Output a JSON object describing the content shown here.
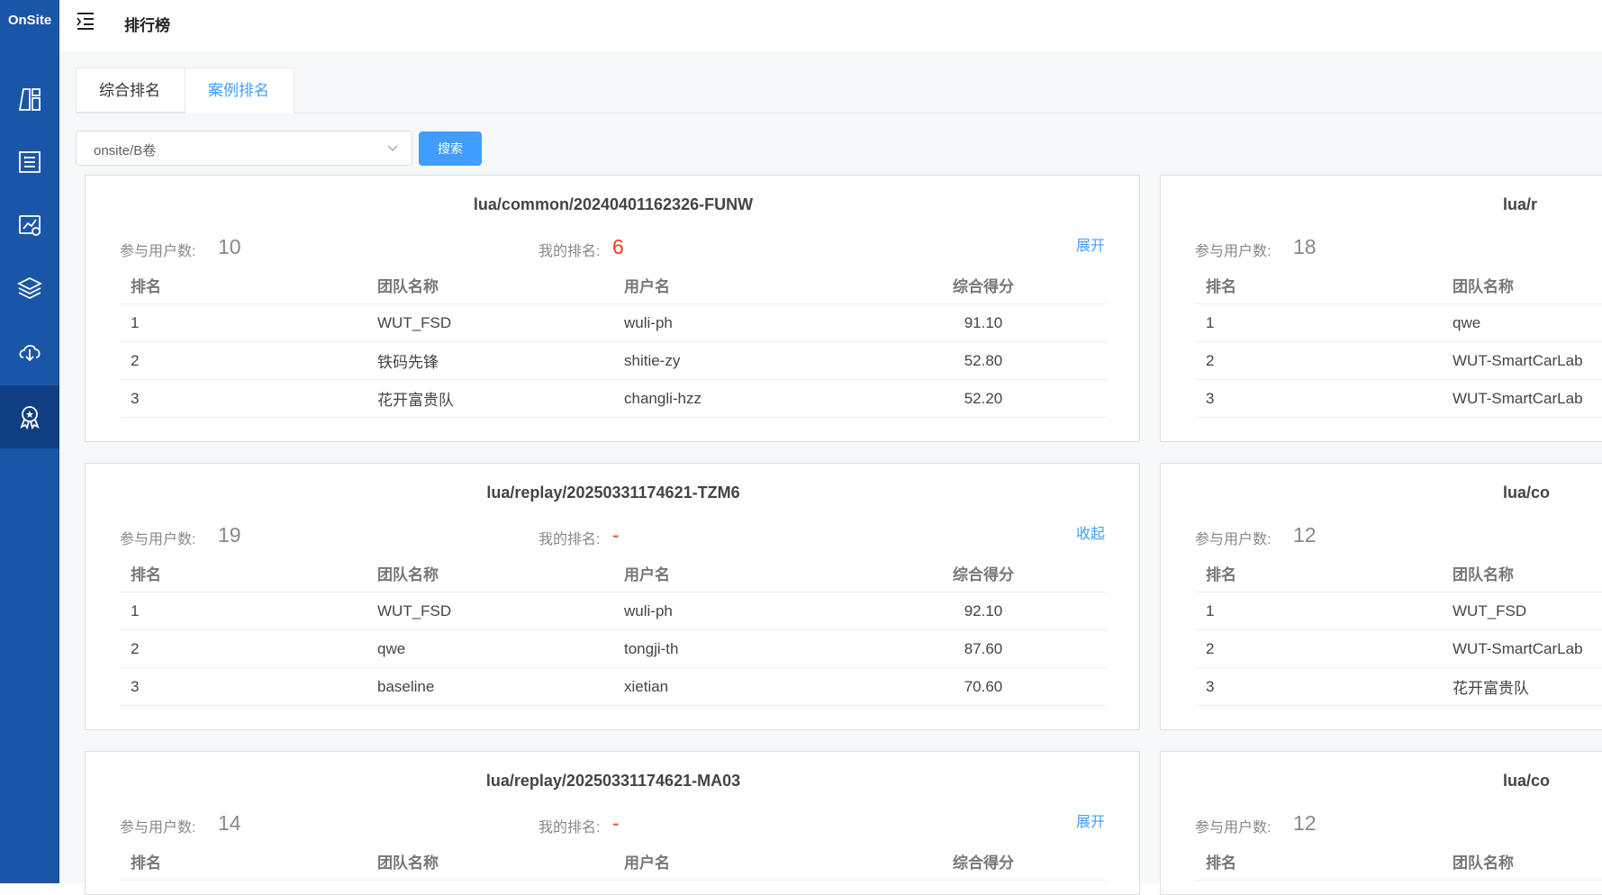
{
  "app": {
    "brand": "OnSite"
  },
  "header": {
    "title": "排行榜"
  },
  "tabs": [
    {
      "label": "综合排名",
      "active": false
    },
    {
      "label": "案例排名",
      "active": true
    }
  ],
  "filter": {
    "selected": "onsite/B卷",
    "search_label": "搜索"
  },
  "labels": {
    "participants": "参与用户数:",
    "my_rank": "我的排名:",
    "col_rank": "排名",
    "col_team": "团队名称",
    "col_user": "用户名",
    "col_score": "综合得分"
  },
  "cards": [
    {
      "title": "lua/common/20240401162326-FUNW",
      "participants": "10",
      "my_rank": "6",
      "toggle": "展开",
      "rows": [
        {
          "rank": "1",
          "team": "WUT_FSD",
          "user": "wuli-ph",
          "score": "91.10"
        },
        {
          "rank": "2",
          "team": "铁码先锋",
          "user": "shitie-zy",
          "score": "52.80"
        },
        {
          "rank": "3",
          "team": "花开富贵队",
          "user": "changli-hzz",
          "score": "52.20"
        }
      ]
    },
    {
      "title": "lua/replay/20250331174621-TZM6",
      "participants": "19",
      "my_rank": "-",
      "toggle": "收起",
      "rows": [
        {
          "rank": "1",
          "team": "WUT_FSD",
          "user": "wuli-ph",
          "score": "92.10"
        },
        {
          "rank": "2",
          "team": "qwe",
          "user": "tongji-th",
          "score": "87.60"
        },
        {
          "rank": "3",
          "team": "baseline",
          "user": "xietian",
          "score": "70.60"
        }
      ]
    },
    {
      "title": "lua/replay/20250331174621-MA03",
      "participants": "14",
      "my_rank": "-",
      "toggle": "展开"
    }
  ],
  "right_cards": [
    {
      "title": "lua/r",
      "participants": "18",
      "rows": [
        {
          "rank": "1",
          "team": "qwe"
        },
        {
          "rank": "2",
          "team": "WUT-SmartCarLab"
        },
        {
          "rank": "3",
          "team": "WUT-SmartCarLab"
        }
      ]
    },
    {
      "title": "lua/co",
      "participants": "12",
      "rows": [
        {
          "rank": "1",
          "team": "WUT_FSD"
        },
        {
          "rank": "2",
          "team": "WUT-SmartCarLab"
        },
        {
          "rank": "3",
          "team": "花开富贵队"
        }
      ]
    },
    {
      "title": "lua/co",
      "participants": "12"
    }
  ],
  "icons": [
    "menu-icon",
    "dashboard-icon",
    "list-icon",
    "chart-icon",
    "layers-icon",
    "cloud-download-icon",
    "award-icon",
    "chevron-down-icon"
  ],
  "colors": {
    "sidebar": "#1a56a7",
    "sidebar_active": "#0f3f82",
    "accent": "#409eff",
    "rank_red": "#f33a1d"
  }
}
